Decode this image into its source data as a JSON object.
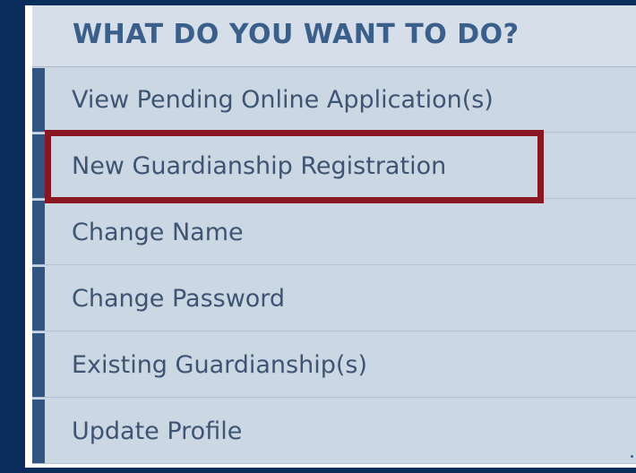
{
  "header": {
    "title": "WHAT DO YOU WANT TO DO?"
  },
  "menu": {
    "items": [
      {
        "label": "View Pending Online Application(s)"
      },
      {
        "label": "New Guardianship Registration"
      },
      {
        "label": "Change Name"
      },
      {
        "label": "Change Password"
      },
      {
        "label": "Existing Guardianship(s)"
      },
      {
        "label": "Update Profile"
      }
    ],
    "highlighted_index": 1
  },
  "colors": {
    "page_background": "#0b2d5c",
    "accent_bar": "#2f5580",
    "highlight_border": "#8a1622",
    "title_text": "#3a5f8a"
  }
}
